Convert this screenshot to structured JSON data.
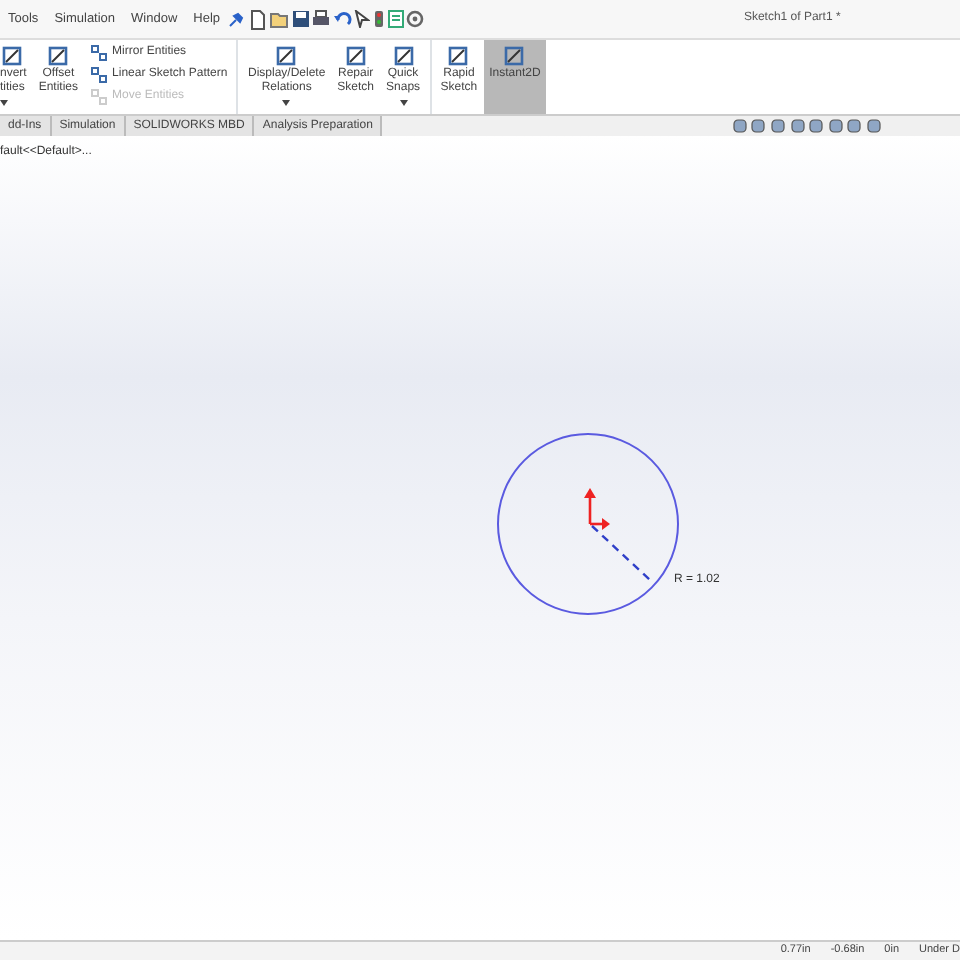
{
  "menu_bar": {
    "items": [
      {
        "label": "Tools"
      },
      {
        "label": "Simulation"
      },
      {
        "label": "Window"
      },
      {
        "label": "Help"
      }
    ],
    "document_title": "Sketch1 of Part1 *"
  },
  "ribbon": {
    "items": [
      {
        "kind": "large",
        "lines": [
          "nvert",
          "tities"
        ],
        "selected": false,
        "dropdown": true
      },
      {
        "kind": "large",
        "lines": [
          "Offset",
          "Entities"
        ],
        "selected": false,
        "dropdown": false
      },
      {
        "kind": "stack",
        "entries": [
          {
            "label": "Mirror Entities",
            "disabled": false
          },
          {
            "label": "Linear Sketch Pattern",
            "disabled": false
          },
          {
            "label": "Move Entities",
            "disabled": true
          }
        ]
      },
      {
        "kind": "large",
        "lines": [
          "Display/Delete",
          "Relations"
        ],
        "selected": false,
        "dropdown": true
      },
      {
        "kind": "large",
        "lines": [
          "Repair",
          "Sketch"
        ],
        "selected": false,
        "dropdown": false
      },
      {
        "kind": "large",
        "lines": [
          "Quick",
          "Snaps"
        ],
        "selected": false,
        "dropdown": true
      },
      {
        "kind": "large",
        "lines": [
          "Rapid",
          "Sketch"
        ],
        "selected": false,
        "dropdown": false
      },
      {
        "kind": "large",
        "lines": [
          "Instant2D"
        ],
        "selected": true,
        "dropdown": false
      }
    ]
  },
  "tabs": [
    {
      "label": "dd-Ins",
      "selected": false
    },
    {
      "label": "Simulation",
      "selected": false
    },
    {
      "label": "SOLIDWORKS MBD",
      "selected": false
    },
    {
      "label": "Analysis Preparation",
      "selected": false
    }
  ],
  "feature_tree_text": "fault<<Default>...",
  "sketch": {
    "dimension": "R = 1.02"
  },
  "status_bar": [
    "0.77in",
    "-0.68in",
    "0in",
    "Under D"
  ]
}
